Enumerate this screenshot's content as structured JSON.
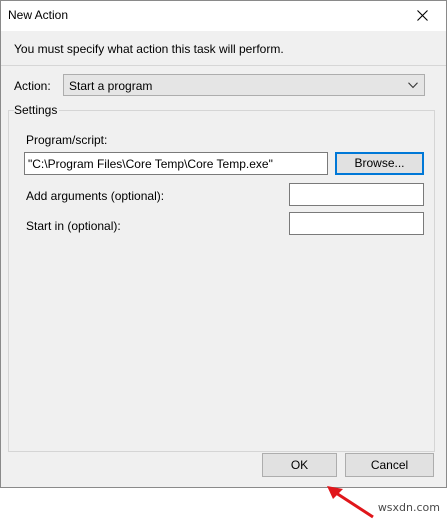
{
  "window": {
    "title": "New Action"
  },
  "instruction": "You must specify what action this task will perform.",
  "action": {
    "label": "Action:",
    "selected": "Start a program"
  },
  "settings": {
    "group_label": "Settings",
    "program_label": "Program/script:",
    "program_value": "\"C:\\Program Files\\Core Temp\\Core Temp.exe\"",
    "browse_label": "Browse...",
    "arguments_label": "Add arguments (optional):",
    "arguments_value": "",
    "startin_label": "Start in (optional):",
    "startin_value": ""
  },
  "buttons": {
    "ok": "OK",
    "cancel": "Cancel"
  },
  "watermark": "wsxdn.com",
  "colors": {
    "focus_border": "#0078d7",
    "annotation_arrow": "#e0161b"
  }
}
